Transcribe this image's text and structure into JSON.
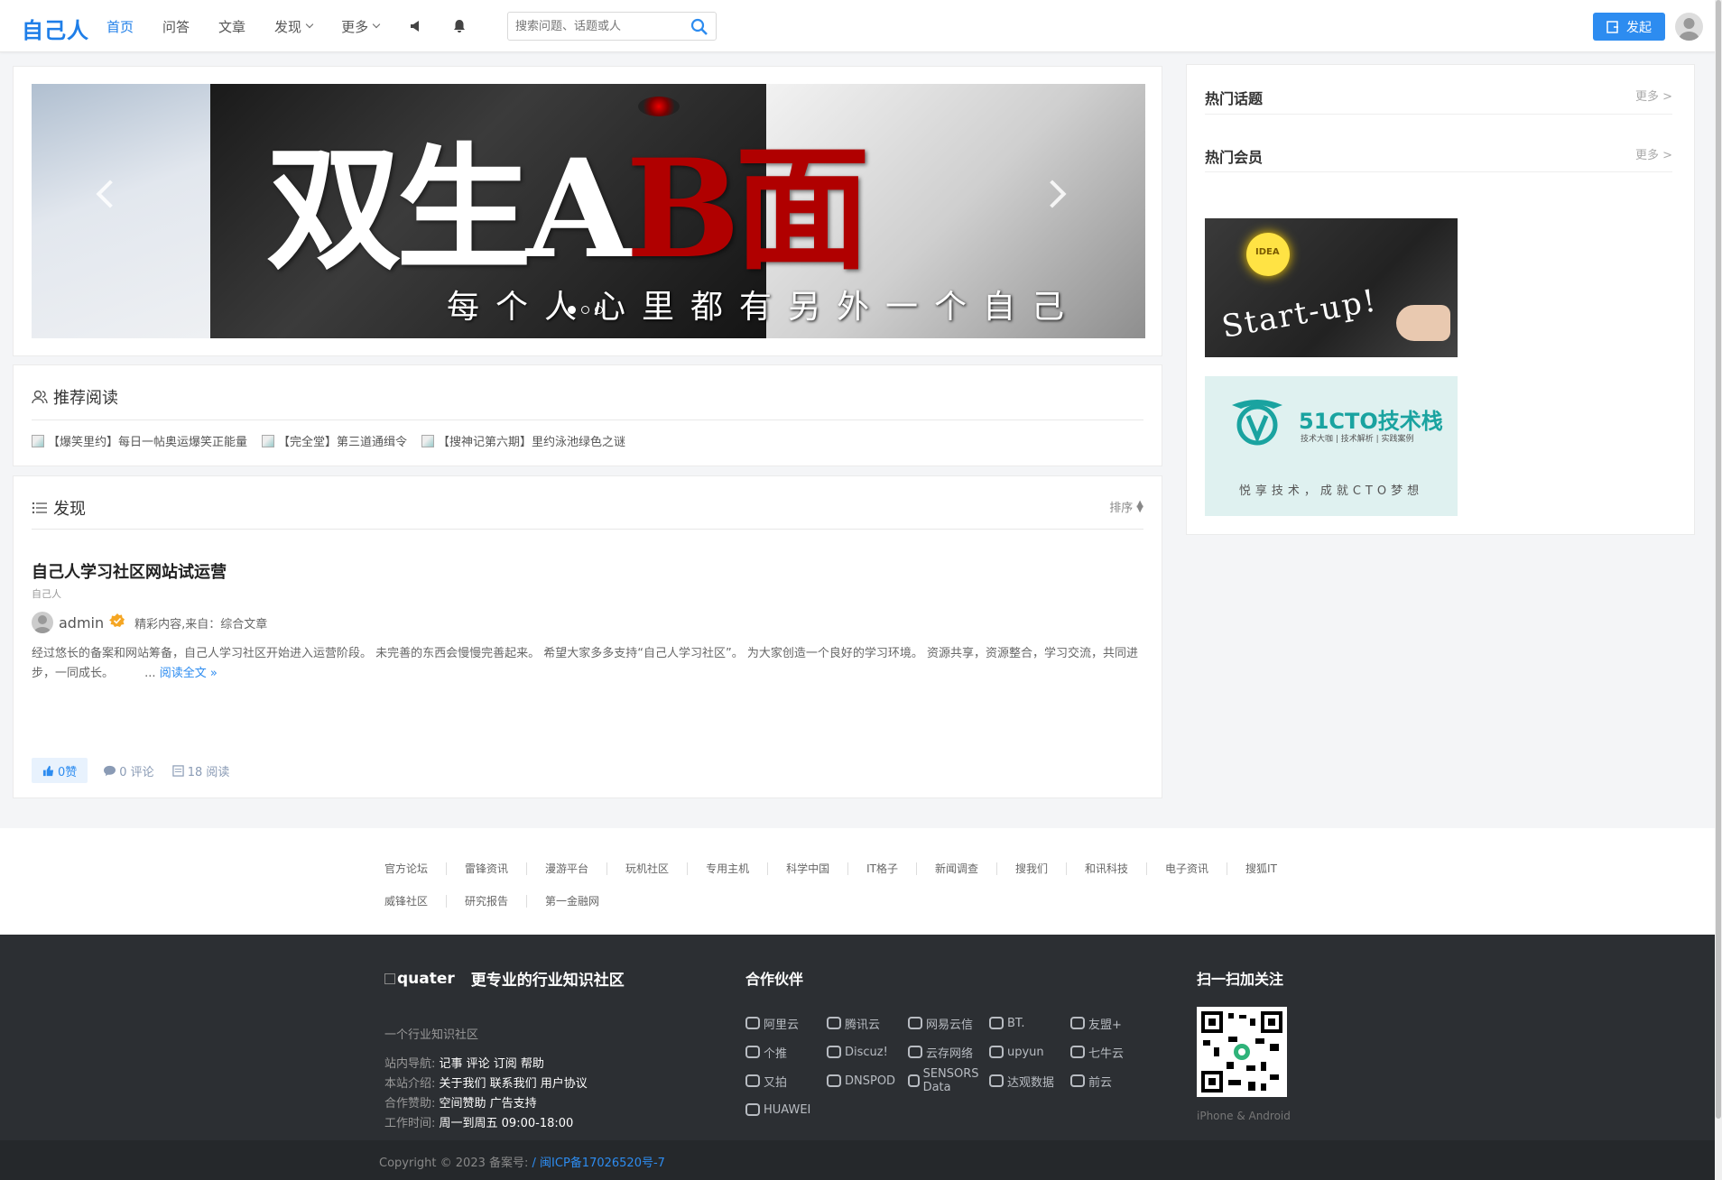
{
  "header": {
    "logo": "自己人",
    "nav": [
      {
        "label": "首页",
        "active": true
      },
      {
        "label": "问答"
      },
      {
        "label": "文章"
      },
      {
        "label": "发现"
      },
      {
        "label": "更多"
      }
    ],
    "search_placeholder": "搜索问题、话题或人",
    "post_button": "发起"
  },
  "carousel": {
    "title_left": "双生A",
    "title_right": "B面",
    "subtitle": "每个人心里都有另外一个自己"
  },
  "recommend": {
    "title": "推荐阅读",
    "items": [
      "【爆笑里约】每日一帖奥运爆笑正能量",
      "【完全堂】第三道通缉令",
      "【搜神记第六期】里约泳池绿色之谜"
    ]
  },
  "discover": {
    "title": "发现",
    "sort_label": "排序",
    "article": {
      "title": "自己人学习社区网站试运营",
      "tag": "自己人",
      "author": "admin",
      "meta": "精彩内容,来自：综合文章",
      "excerpt": "经过悠长的备案和网站筹备，自己人学习社区开始进入运营阶段。 未完善的东西会慢慢完善起来。 希望大家多多支持“自己人学习社区”。 为大家创造一个良好的学习环境。 资源共享，资源整合，学习交流，共同进步，一同成长。",
      "ellipsis": "...",
      "read_more": "阅读全文",
      "likes": "0赞",
      "comments": "0 评论",
      "views": "18 阅读"
    }
  },
  "sidebar": {
    "hot_topics": "热门话题",
    "hot_members": "热门会员",
    "more": "更多 >",
    "ad1_text": "Start-up!",
    "ad1_bulb": "IDEA",
    "ad2_logo": "51CTO技术栈",
    "ad2_sub": "技术大咖 | 技术解析 | 实践案例",
    "ad2_slogan": "悦享技术，成就CTO梦想"
  },
  "links": {
    "row1": [
      "官方论坛",
      "雷锋资讯",
      "漫游平台",
      "玩机社区",
      "专用主机",
      "科学中国",
      "IT格子",
      "新闻调查",
      "搜我们",
      "和讯科技",
      "电子资讯",
      "搜狐IT"
    ],
    "row2": [
      "威锋社区",
      "研究报告",
      "第一金融网"
    ]
  },
  "footer": {
    "logo_alt": "quater",
    "slogan": "更专业的行业知识社区",
    "desc": "一个行业知识社区",
    "nav_label": "站内导航:",
    "nav_value": "记事 评论 订阅 帮助",
    "about_label": "本站介绍:",
    "about_value": "关于我们 联系我们 用户协议",
    "sponsor_label": "合作赞助:",
    "sponsor_value": "空间赞助 广告支持",
    "hours_label": "工作时间:",
    "hours_value": "周一到周五 09:00-18:00",
    "partners_title": "合作伙伴",
    "partners": [
      "阿里云",
      "腾讯云",
      "网易云信",
      "BT.",
      "友盟+",
      "个推",
      "Discuz!",
      "云存网络",
      "upyun",
      "七牛云",
      "又拍",
      "DNSPOD",
      "SENSORS Data",
      "达观数据",
      "前云",
      "HUAWEI"
    ],
    "qr_title": "扫一扫加关注",
    "qr_note": "iPhone & Android",
    "copyright": "Copyright © 2023 备案号:",
    "icp": "/ 闽ICP备17026520号-7"
  },
  "colors": {
    "accent": "#2d8cf0",
    "logo": "#1e7ee8",
    "footer_bg": "#2c2f33"
  }
}
